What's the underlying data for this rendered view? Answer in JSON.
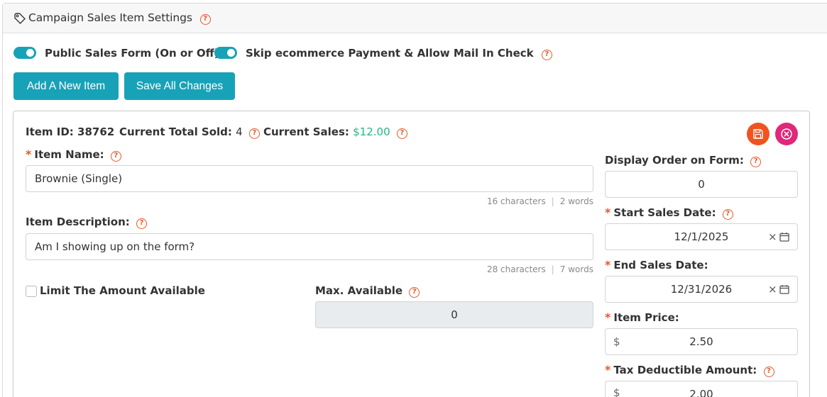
{
  "header": {
    "title": "Campaign Sales Item Settings"
  },
  "toggles": {
    "public_form_label": "Public Sales Form (On or Off)",
    "skip_ecommerce_label": "Skip ecommerce Payment & Allow Mail In Check"
  },
  "buttons": {
    "add_item": "Add A New Item",
    "save_all": "Save All Changes"
  },
  "item": {
    "id_label": "Item ID:",
    "id_value": "38762",
    "sold_label": "Current Total Sold:",
    "sold_value": "4",
    "sales_label": "Current Sales:",
    "sales_value": "$12.00",
    "name_label": "Item Name:",
    "name_value": "Brownie (Single)",
    "name_chars": "16 characters",
    "name_words": "2 words",
    "desc_label": "Item Description:",
    "desc_value": "Am I showing up on the form?",
    "desc_chars": "28 characters",
    "desc_words": "7 words",
    "limit_label": "Limit The Amount Available",
    "max_label": "Max. Available",
    "max_value": "0",
    "display_order_label": "Display Order on Form:",
    "display_order_value": "0",
    "start_date_label": "Start Sales Date:",
    "start_date_value": "12/1/2025",
    "end_date_label": "End Sales Date:",
    "end_date_value": "12/31/2026",
    "price_label": "Item Price:",
    "price_currency": "$",
    "price_value": "2.50",
    "tax_label": "Tax Deductible Amount:",
    "tax_currency": "$",
    "tax_value": "2.00"
  },
  "colors": {
    "accent": "#17a2b8",
    "help": "#e8572a",
    "money": "#28b485",
    "save_round": "#f0541e",
    "close_round": "#e0277a"
  }
}
